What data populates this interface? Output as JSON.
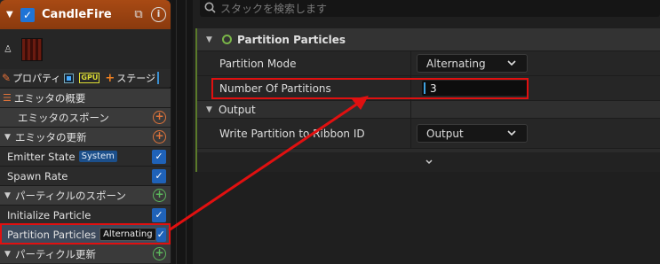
{
  "emitter": {
    "name": "CandleFire",
    "enabled": true
  },
  "stage_tabs": {
    "properties_label": "プロパティ",
    "gpu_label": "GPU",
    "stage_label": "ステージ"
  },
  "stack": {
    "items": [
      {
        "label": "エミッタの概要",
        "type": "header"
      },
      {
        "label": "エミッタのスポーン",
        "type": "section"
      },
      {
        "label": "エミッタの更新",
        "type": "section"
      },
      {
        "label": "Emitter State",
        "tag": "System",
        "type": "item"
      },
      {
        "label": "Spawn Rate",
        "type": "item"
      },
      {
        "label": "パーティクルのスポーン",
        "type": "section"
      },
      {
        "label": "Initialize Particle",
        "type": "item"
      },
      {
        "label": "Partition Particles",
        "tag": "Alternating",
        "type": "item",
        "selected": true
      },
      {
        "label": "パーティクル更新",
        "type": "section"
      }
    ]
  },
  "search": {
    "placeholder": "スタックを検索します"
  },
  "details": {
    "module_title": "Partition Particles",
    "partition_mode_label": "Partition Mode",
    "partition_mode_value": "Alternating",
    "number_of_partitions_label": "Number Of Partitions",
    "number_of_partitions_value": "3",
    "output_category": "Output",
    "write_partition_label": "Write Partition to Ribbon ID",
    "write_partition_value": "Output"
  },
  "colors": {
    "accent_blue": "#1f62b8",
    "emitter_header": "#a84a14",
    "annotation_red": "#e01010"
  }
}
